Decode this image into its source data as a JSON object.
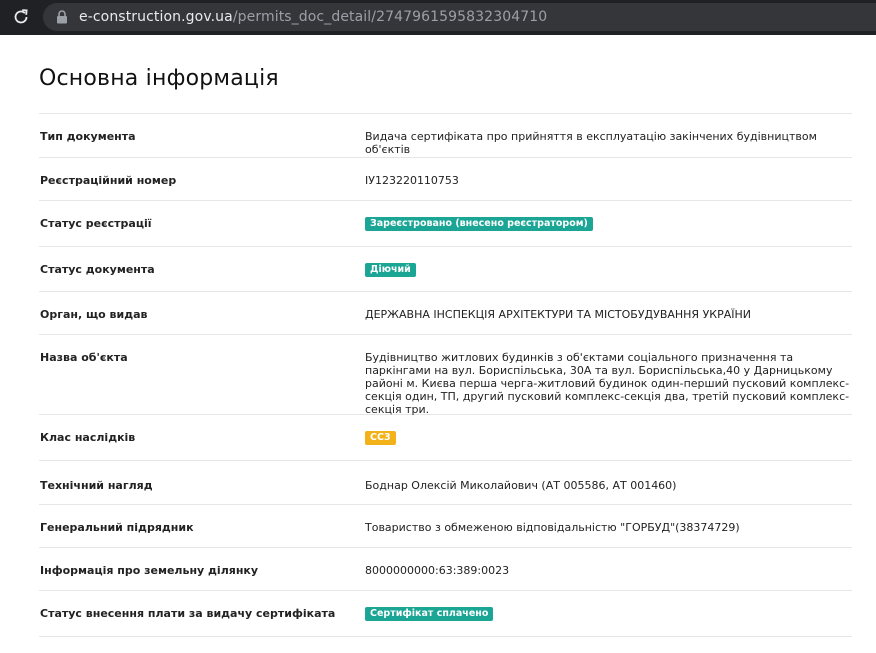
{
  "browser": {
    "url_host": "e-construction.gov.ua",
    "url_path": "/permits_doc_detail/2747961595832304710"
  },
  "page": {
    "title": "Основна інформація"
  },
  "rows": [
    {
      "label": "Тип документа",
      "value": "Видача сертифіката про прийняття в експлуатацію закінчених будівництвом об'єктів"
    },
    {
      "label": "Реєстраційний номер",
      "value": "IУ123220110753"
    },
    {
      "label": "Статус реєстрації",
      "badge": "Зареєстровано (внесено реєстратором)",
      "badge_color": "#1aa594"
    },
    {
      "label": "Статус документа",
      "badge": "Діючий",
      "badge_color": "#1aa594"
    },
    {
      "label": "Орган, що видав",
      "value": "ДЕРЖАВНА ІНСПЕКЦІЯ АРХІТЕКТУРИ ТА МІСТОБУДУВАННЯ УКРАЇНИ"
    },
    {
      "label": "Назва об'єкта",
      "value": "Будівництво житлових будинків з об'єктами соціального призначення та паркінгами на вул. Бориспільська, 30А та вул. Бориспільська,40 у Дарницькому районі м. Києва перша черга-житловий будинок один-перший пусковий комплекс-секція один, ТП, другий пусковий комплекс-секція два, третій пусковий комплекс-секція три."
    },
    {
      "label": "Клас наслідків",
      "badge": "СС3",
      "badge_color": "#f3b21a"
    },
    {
      "label": "Технічний нагляд",
      "value": "Боднар Олексій Миколайович (АТ 005586, АТ 001460)"
    },
    {
      "label": "Генеральний підрядник",
      "value": "Товариство з обмеженою відповідальністю \"ГОРБУД\"(38374729)"
    },
    {
      "label": "Інформація про земельну ділянку",
      "value": "8000000000:63:389:0023"
    },
    {
      "label": "Статус внесення плати за видачу сертифіката",
      "badge": "Сертифікат сплачено",
      "badge_color": "#1aa594"
    }
  ]
}
